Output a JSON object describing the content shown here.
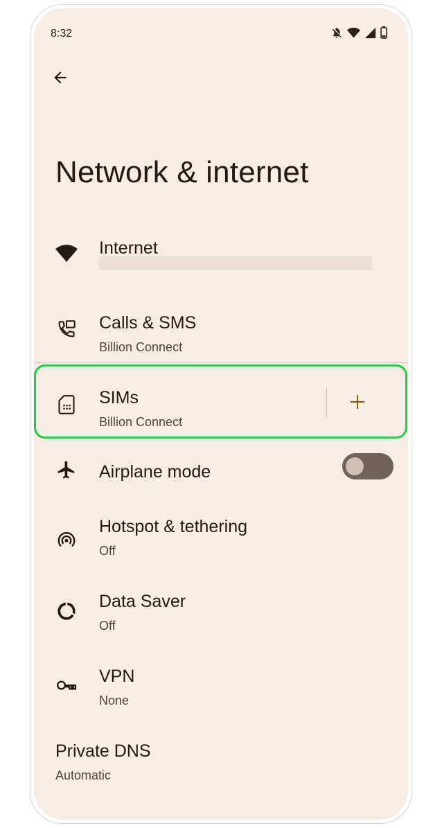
{
  "status_bar": {
    "time": "8:32",
    "icons": [
      "notifications-off-icon",
      "wifi-icon",
      "cell-signal-icon",
      "battery-icon"
    ]
  },
  "header": {
    "back_icon": "arrow-left-icon",
    "title": "Network & internet"
  },
  "items": [
    {
      "id": "internet",
      "title": "Internet",
      "subtitle": "",
      "icon": "wifi-icon"
    },
    {
      "id": "calls-sms",
      "title": "Calls & SMS",
      "subtitle": "Billion Connect",
      "icon": "phone-message-icon"
    },
    {
      "id": "sims",
      "title": "SIMs",
      "subtitle": "Billion Connect",
      "icon": "sim-card-icon",
      "action_icon": "plus-icon"
    },
    {
      "id": "airplane-mode",
      "title": "Airplane mode",
      "subtitle": "",
      "icon": "airplane-icon",
      "toggle_on": false
    },
    {
      "id": "hotspot",
      "title": "Hotspot & tethering",
      "subtitle": "Off",
      "icon": "hotspot-icon"
    },
    {
      "id": "data-saver",
      "title": "Data Saver",
      "subtitle": "Off",
      "icon": "data-saver-icon"
    },
    {
      "id": "vpn",
      "title": "VPN",
      "subtitle": "None",
      "icon": "key-icon"
    },
    {
      "id": "private-dns",
      "title": "Private DNS",
      "subtitle": "Automatic",
      "icon": ""
    }
  ],
  "colors": {
    "background": "#f8ede5",
    "text_primary": "#211a15",
    "text_secondary": "#52443b",
    "accent": "#8a5a00",
    "highlight": "#22cc44",
    "toggle_track_off": "#6f635b",
    "toggle_knob_off": "#cfc0b4"
  }
}
